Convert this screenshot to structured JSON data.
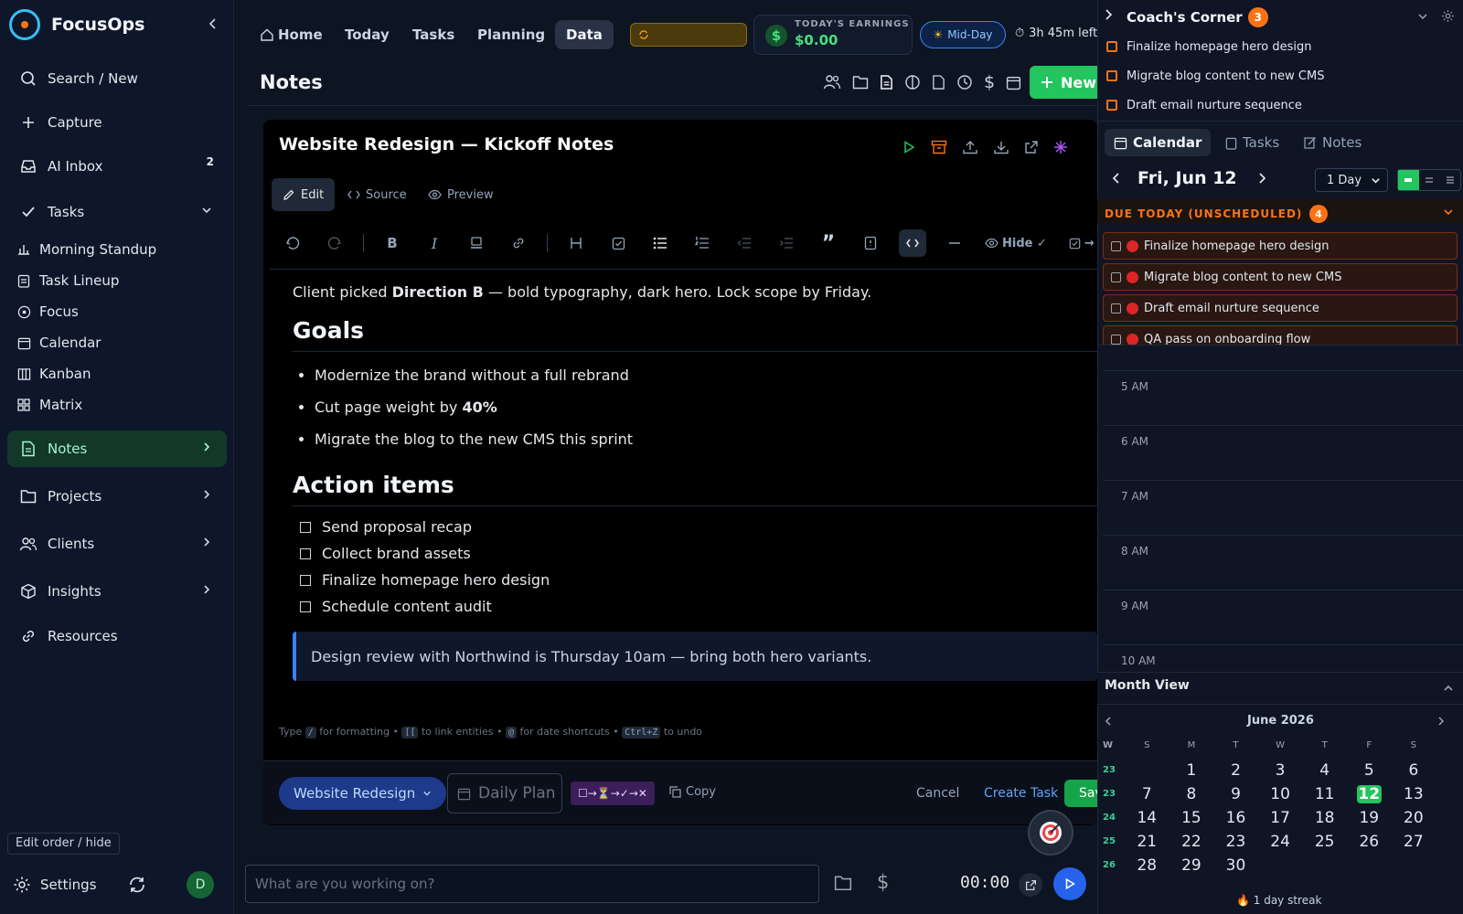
{
  "app": {
    "name": "FocusOps"
  },
  "sidebar": {
    "items": [
      {
        "label": "Search / New",
        "icon": "search-icon"
      },
      {
        "label": "Capture",
        "icon": "plus-icon"
      },
      {
        "label": "AI Inbox",
        "icon": "inbox-icon",
        "badge": "2"
      },
      {
        "label": "Tasks",
        "icon": "check-icon"
      }
    ],
    "task_views": [
      {
        "label": "Morning Standup",
        "icon": "sliders-icon"
      },
      {
        "label": "Task Lineup",
        "icon": "clipboard-icon"
      },
      {
        "label": "Focus",
        "icon": "target-icon"
      },
      {
        "label": "Calendar",
        "icon": "calendar-icon"
      },
      {
        "label": "Kanban",
        "icon": "kanban-icon"
      },
      {
        "label": "Matrix",
        "icon": "grid-icon"
      }
    ],
    "sections": [
      {
        "label": "Notes",
        "icon": "note-icon",
        "active": true
      },
      {
        "label": "Projects",
        "icon": "folder-icon"
      },
      {
        "label": "Clients",
        "icon": "users-icon"
      },
      {
        "label": "Insights",
        "icon": "cube-icon"
      },
      {
        "label": "Resources",
        "icon": "link-icon"
      }
    ],
    "edit_order": "Edit order / hide",
    "settings": "Settings",
    "avatar_initial": "D"
  },
  "topnav": {
    "tabs": [
      "Home",
      "Today",
      "Tasks",
      "Planning",
      "Data"
    ],
    "active": "Data",
    "earnings_label": "TODAY'S EARNINGS",
    "earnings_value": "$0.00",
    "phase": "Mid-Day",
    "time_left": "3h 45m left"
  },
  "page": {
    "title": "Notes",
    "new_button": "New"
  },
  "note": {
    "title": "Website Redesign — Kickoff Notes",
    "modes": [
      "Edit",
      "Source",
      "Preview"
    ],
    "toolbar_hide": "Hide ✓",
    "toolbar_more": "→ D",
    "intro_pre": "Client picked ",
    "intro_bold": "Direction B",
    "intro_post": " — bold typography, dark hero. Lock scope by Friday.",
    "goals_heading": "Goals",
    "goals": [
      {
        "pre": "Modernize the brand without a full rebrand",
        "bold": ""
      },
      {
        "pre": "Cut page weight by ",
        "bold": "40%"
      },
      {
        "pre": "Migrate the blog to the new CMS this sprint",
        "bold": ""
      }
    ],
    "actions_heading": "Action items",
    "actions": [
      "Send proposal recap",
      "Collect brand assets",
      "Finalize homepage hero design",
      "Schedule content audit"
    ],
    "quote": "Design review with Northwind is Thursday 10am — bring both hero variants.",
    "hint": {
      "t1": "Type",
      "k1": "/",
      "t2": "for formatting •",
      "k2": "[[",
      "t3": "to link entities •",
      "k3": "@",
      "t4": "for date shortcuts •",
      "k4": "Ctrl+Z",
      "t5": "to undo"
    }
  },
  "footer": {
    "project": "Website Redesign",
    "daily_plan": "Daily Plan",
    "chain": "☐→⏳→✓→✕",
    "copy": "Copy",
    "cancel": "Cancel",
    "create_task": "Create Task",
    "save": "Sav"
  },
  "bottom": {
    "placeholder": "What are you working on?",
    "timer": "00:00"
  },
  "coach": {
    "title": "Coach's Corner",
    "count": "3",
    "items": [
      "Finalize homepage hero design",
      "Migrate blog content to new CMS",
      "Draft email nurture sequence"
    ]
  },
  "right_tabs": [
    "Calendar",
    "Tasks",
    "Notes"
  ],
  "calendar": {
    "date": "Fri, Jun 12",
    "range": "1 Day",
    "due_title": "DUE TODAY (UNSCHEDULED)",
    "due_count": "4",
    "due_items": [
      "Finalize homepage hero design",
      "Migrate blog content to new CMS",
      "Draft email nurture sequence",
      "QA pass on onboarding flow"
    ],
    "hours": [
      "5 AM",
      "6 AM",
      "7 AM",
      "8 AM",
      "9 AM",
      "10 AM"
    ]
  },
  "month": {
    "title": "Month View",
    "label": "June 2026",
    "week_label": "W",
    "days": [
      "S",
      "M",
      "T",
      "W",
      "T",
      "F",
      "S"
    ],
    "weeks": [
      {
        "wk": "23",
        "days": [
          "",
          "1",
          "2",
          "3",
          "4",
          "5",
          "6"
        ]
      },
      {
        "wk": "23",
        "days": [
          "7",
          "8",
          "9",
          "10",
          "11",
          "12",
          "13"
        ]
      },
      {
        "wk": "24",
        "days": [
          "14",
          "15",
          "16",
          "17",
          "18",
          "19",
          "20"
        ]
      },
      {
        "wk": "25",
        "days": [
          "21",
          "22",
          "23",
          "24",
          "25",
          "26",
          "27"
        ]
      },
      {
        "wk": "26",
        "days": [
          "28",
          "29",
          "30",
          "",
          "",
          "",
          ""
        ]
      }
    ],
    "today": "12",
    "streak": "🔥 1 day streak"
  },
  "colors": {
    "accent": "#22c55e",
    "warning": "#f97316",
    "link": "#60a5fa"
  }
}
